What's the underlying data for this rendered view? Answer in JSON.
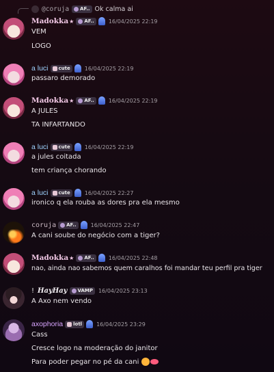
{
  "reply": {
    "author": "@coruja",
    "tag": "AF..",
    "text": "Ok calma ai"
  },
  "messages": [
    {
      "author": "Madokka",
      "suffix": "★",
      "tag": "AF..",
      "time": "16/04/2025 22:19",
      "lines": [
        "VEM",
        "LOGO"
      ]
    },
    {
      "author": "a luci",
      "tag": "cute",
      "time": "16/04/2025 22:19",
      "lines": [
        "passaro demorado"
      ]
    },
    {
      "author": "Madokka",
      "suffix": "★",
      "tag": "AF..",
      "time": "16/04/2025 22:19",
      "lines": [
        "A JULES",
        "TA INFARTANDO"
      ]
    },
    {
      "author": "a luci",
      "tag": "cute",
      "time": "16/04/2025 22:19",
      "lines": [
        "a jules coitada",
        "tem criança chorando"
      ]
    },
    {
      "author": "a luci",
      "tag": "cute",
      "time": "16/04/2025 22:27",
      "lines": [
        "ironico q ela rouba as dores pra ela mesmo"
      ]
    },
    {
      "author": "coruja",
      "tag": "AF..",
      "time": "16/04/2025 22:47",
      "lines": [
        "A cani soube do negócio com a tiger?"
      ]
    },
    {
      "author": "Madokka",
      "suffix": "★",
      "tag": "AF..",
      "time": "16/04/2025 22:48",
      "lines": [
        "nao, ainda nao sabemos quem caralhos foi mandar teu perfil pra tiger"
      ]
    },
    {
      "author": "HayHay",
      "prefix": "!",
      "tag": "VAMP",
      "time": "16/04/2025 23:13",
      "lines": [
        "A Axo nem vendo"
      ]
    },
    {
      "author": "axophoria",
      "tag": "lotl",
      "time": "16/04/2025 23:29",
      "lines": [
        "Cass",
        "Cresce logo na moderação do janitor",
        "Para poder pegar no pé da cani"
      ]
    }
  ],
  "icons": {
    "role": "ghost-badge-icon",
    "tag": "guild-tag-icon",
    "emoji": [
      "smiling-face-hearts-icon",
      "kiss-mark-icon"
    ]
  }
}
